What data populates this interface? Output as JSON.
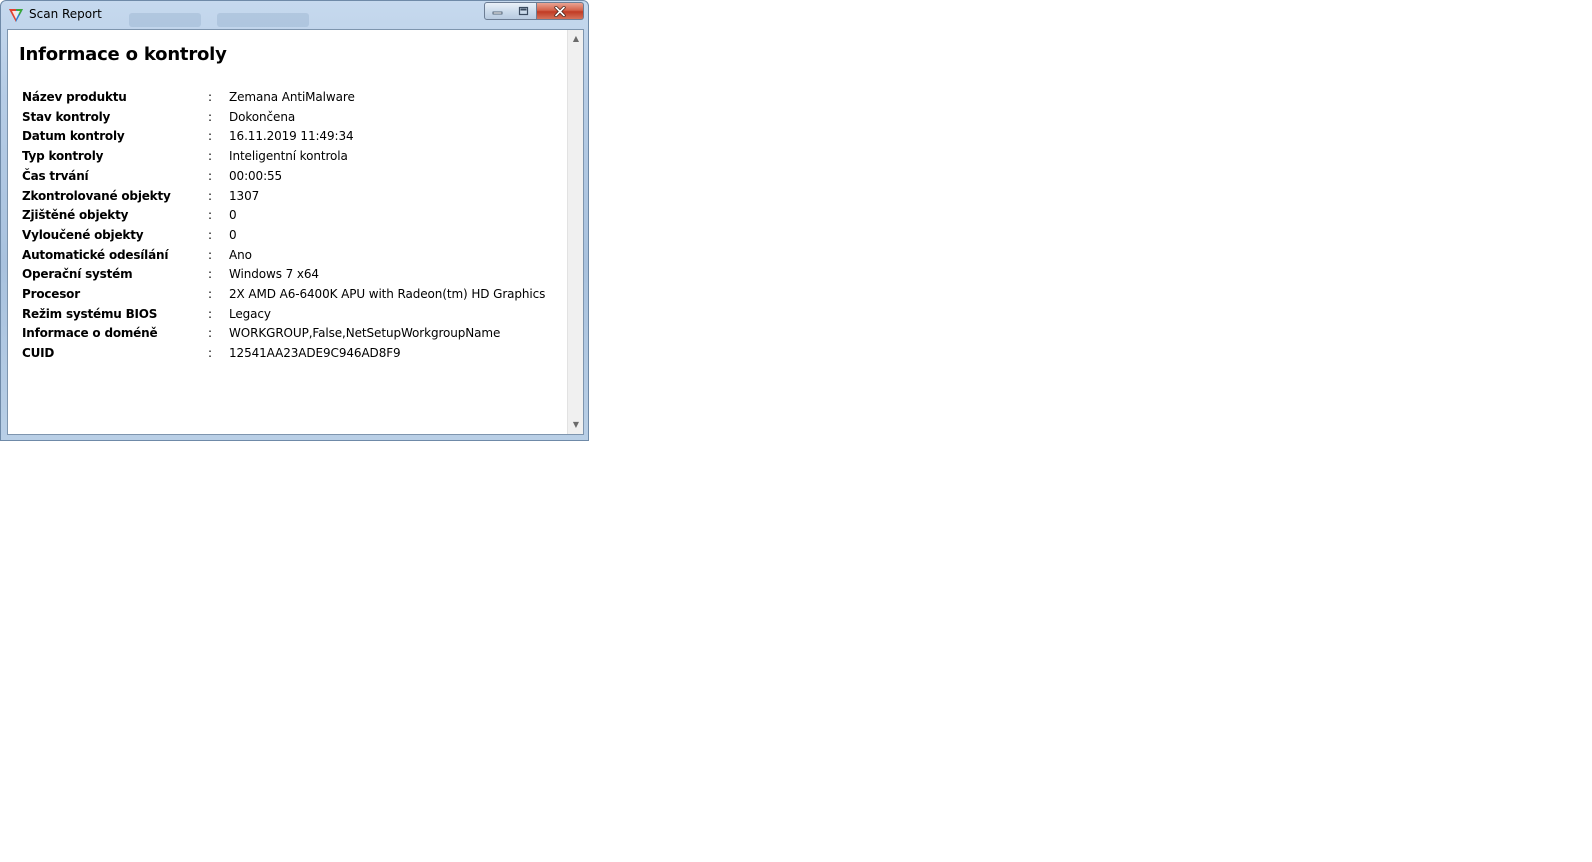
{
  "window": {
    "title": "Scan Report"
  },
  "report": {
    "heading": "Informace o kontroly",
    "rows": [
      {
        "label": "Název produktu",
        "sep": ":",
        "value": "Zemana AntiMalware"
      },
      {
        "label": "Stav kontroly",
        "sep": ":",
        "value": "Dokončena"
      },
      {
        "label": "Datum kontroly",
        "sep": ":",
        "value": "16.11.2019 11:49:34"
      },
      {
        "label": "Typ kontroly",
        "sep": ":",
        "value": "Inteligentní kontrola"
      },
      {
        "label": "Čas trvání",
        "sep": ":",
        "value": "00:00:55"
      },
      {
        "label": "Zkontrolované objekty",
        "sep": ":",
        "value": "1307"
      },
      {
        "label": "Zjištěné objekty",
        "sep": ":",
        "value": "0"
      },
      {
        "label": "Vyloučené objekty",
        "sep": ":",
        "value": "0"
      },
      {
        "label": "Automatické odesílání",
        "sep": ":",
        "value": "Ano"
      },
      {
        "label": "Operační systém",
        "sep": ":",
        "value": "Windows 7 x64"
      },
      {
        "label": "Procesor",
        "sep": ":",
        "value": "2X AMD A6-6400K APU with Radeon(tm) HD Graphics"
      },
      {
        "label": "Režim systému BIOS",
        "sep": ":",
        "value": "Legacy"
      },
      {
        "label": "Informace o doméně",
        "sep": ":",
        "value": "WORKGROUP,False,NetSetupWorkgroupName"
      },
      {
        "label": "CUID",
        "sep": ":",
        "value": "12541AA23ADE9C946AD8F9"
      }
    ]
  },
  "icons": {
    "app": "zemana-logo-icon",
    "minimize": "minimize-icon",
    "maximize": "maximize-icon",
    "close": "close-icon",
    "scroll_up": "scroll-up-arrow-icon",
    "scroll_down": "scroll-down-arrow-icon"
  },
  "colors": {
    "frame": "#b7cde6",
    "close_button": "#c94a33",
    "content_background": "#ffffff"
  }
}
